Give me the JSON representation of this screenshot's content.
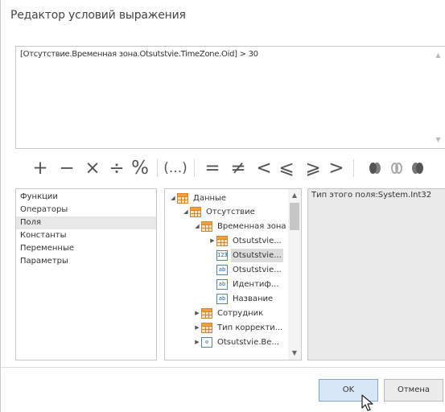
{
  "window": {
    "title": "Редактор условий выражения"
  },
  "expression": {
    "text": "[Отсутствие.Временная зона.Otsutstvie.TimeZone.Oid] > 30"
  },
  "operators": {
    "plus": "+",
    "minus": "−",
    "multiply": "×",
    "divide": "÷",
    "modulo": "%",
    "parens": "(...)",
    "equal": "=",
    "not_equal": "≠",
    "less": "<",
    "less_equal": "⩽",
    "greater_equal": "⩾",
    "greater": ">",
    "logic_icons": [
      "and-icon",
      "or-icon",
      "not-icon"
    ]
  },
  "categories": {
    "items": [
      "Функции",
      "Операторы",
      "Поля",
      "Константы",
      "Переменные",
      "Параметры"
    ],
    "selected": "Поля"
  },
  "tree": {
    "nodes": [
      {
        "label": "Данные",
        "icon": "table-icon",
        "expanded": true
      },
      {
        "label": "Отсутствие",
        "icon": "table-icon",
        "expanded": true
      },
      {
        "label": "Временная зона",
        "icon": "table-icon",
        "expanded": true
      },
      {
        "label": "Otsutstvie...",
        "icon": "table-icon",
        "expanded": false
      },
      {
        "label": "Otsutstvie...",
        "icon": "number-field-icon",
        "selected": true
      },
      {
        "label": "Otsutstvie...",
        "icon": "text-field-icon"
      },
      {
        "label": "Идентиф...",
        "icon": "text-field-icon"
      },
      {
        "label": "Название",
        "icon": "text-field-icon"
      },
      {
        "label": "Сотрудник",
        "icon": "table-icon",
        "expanded": false
      },
      {
        "label": "Тип корректи...",
        "icon": "table-icon",
        "expanded": false
      },
      {
        "label": "Otsutstvie.Ве...",
        "icon": "date-field-icon"
      }
    ],
    "icon_text": {
      "number": "123",
      "text": "ab",
      "date": "⊙"
    }
  },
  "description": {
    "text": "Тип этого поля:System.Int32"
  },
  "buttons": {
    "ok": "OK",
    "cancel": "Отмена"
  },
  "colors": {
    "accent": "#d8e7f7",
    "selection": "#e8e8e8"
  }
}
